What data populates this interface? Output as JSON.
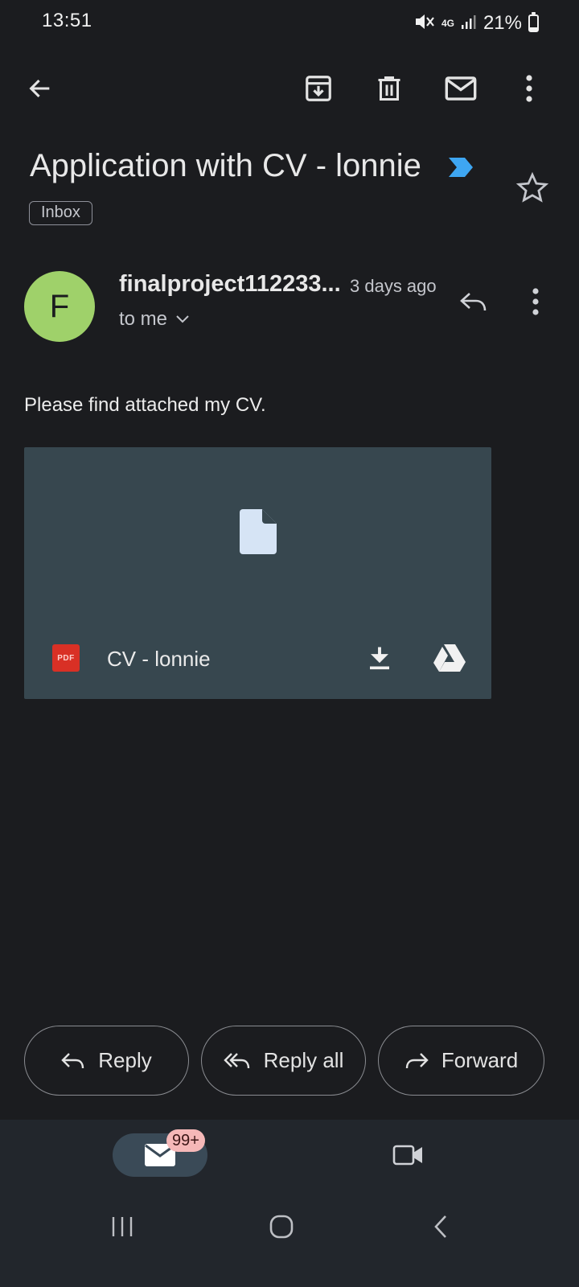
{
  "status_bar": {
    "time": "13:51",
    "network": "4G",
    "battery": "21%"
  },
  "email": {
    "subject": "Application with CV - lonnie",
    "label": "Inbox",
    "sender_initial": "F",
    "sender": "finalproject112233...",
    "time": "3 days ago",
    "recipient": "to me",
    "body": "Please find attached my CV.",
    "attachment": {
      "type": "PDF",
      "name": "CV - lonnie"
    }
  },
  "actions": {
    "reply": "Reply",
    "reply_all": "Reply all",
    "forward": "Forward"
  },
  "nav": {
    "mail_badge": "99+"
  },
  "colors": {
    "background": "#1b1c1f",
    "avatar": "#9fd16a",
    "attachment_bg": "#37474f",
    "importance": "#3ea6f2"
  }
}
